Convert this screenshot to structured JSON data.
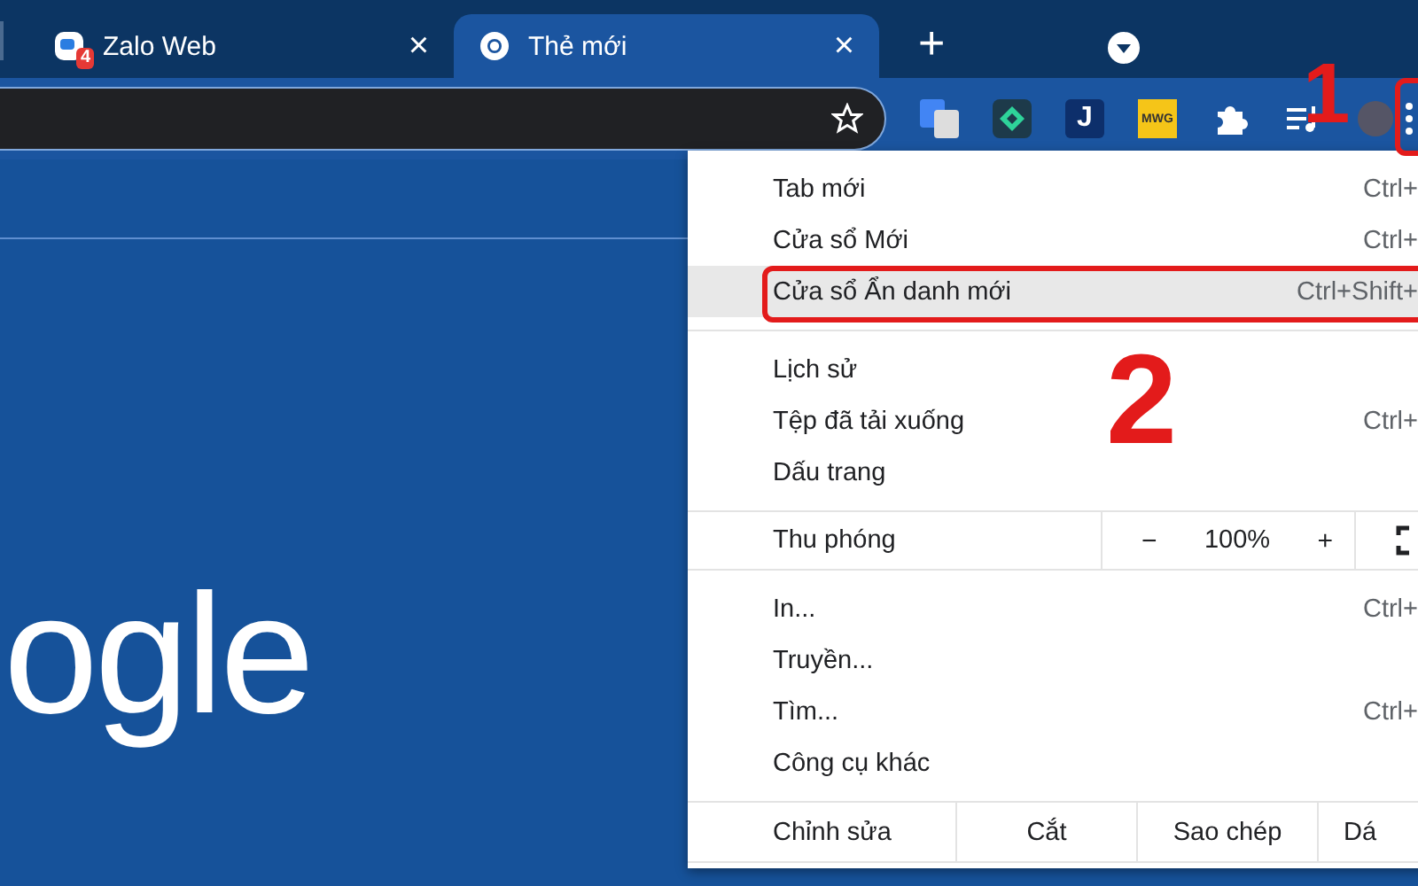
{
  "tabs": [
    {
      "title": "Zalo Web",
      "kind": "chat",
      "badge": "4",
      "close": "×",
      "selected": false
    },
    {
      "title": "Thẻ mới",
      "kind": "browser",
      "close": "×",
      "selected": true
    }
  ],
  "new_tab_button": "+",
  "extensions": [
    {
      "kind": "translate"
    },
    {
      "kind": "diamond"
    },
    {
      "kind": "letter",
      "label": "J"
    },
    {
      "kind": "tag",
      "label": "MWG"
    },
    {
      "kind": "puzzle"
    },
    {
      "kind": "media"
    },
    {
      "kind": "avatar"
    }
  ],
  "page": {
    "logo_text": "ogle"
  },
  "menu": {
    "groups": [
      {
        "kind": "items",
        "items": [
          {
            "label": "Tab mới",
            "shortcut": "Ctrl+",
            "highlighted": false
          },
          {
            "label": "Cửa sổ Mới",
            "shortcut": "Ctrl+",
            "highlighted": false
          },
          {
            "label": "Cửa sổ Ẩn danh mới",
            "shortcut": "Ctrl+Shift+",
            "highlighted": true
          }
        ]
      },
      {
        "kind": "items",
        "items": [
          {
            "label": "Lịch sử",
            "highlighted": false
          },
          {
            "label": "Tệp đã tải xuống",
            "shortcut": "Ctrl+",
            "highlighted": false
          },
          {
            "label": "Dấu trang",
            "highlighted": false
          }
        ]
      },
      {
        "kind": "zoom",
        "label": "Thu phóng",
        "minus": "−",
        "value": "100%",
        "plus": "+"
      },
      {
        "kind": "items",
        "items": [
          {
            "label": "In...",
            "shortcut": "Ctrl+",
            "highlighted": false
          },
          {
            "label": "Truyền...",
            "highlighted": false
          },
          {
            "label": "Tìm...",
            "shortcut": "Ctrl+",
            "highlighted": false
          },
          {
            "label": "Công cụ khác",
            "highlighted": false
          }
        ]
      },
      {
        "kind": "edit",
        "label": "Chỉnh sửa",
        "actions": [
          "Cắt",
          "Sao chép",
          "Dá"
        ]
      }
    ]
  },
  "annotations": [
    {
      "label": "1"
    },
    {
      "label": "2"
    }
  ]
}
